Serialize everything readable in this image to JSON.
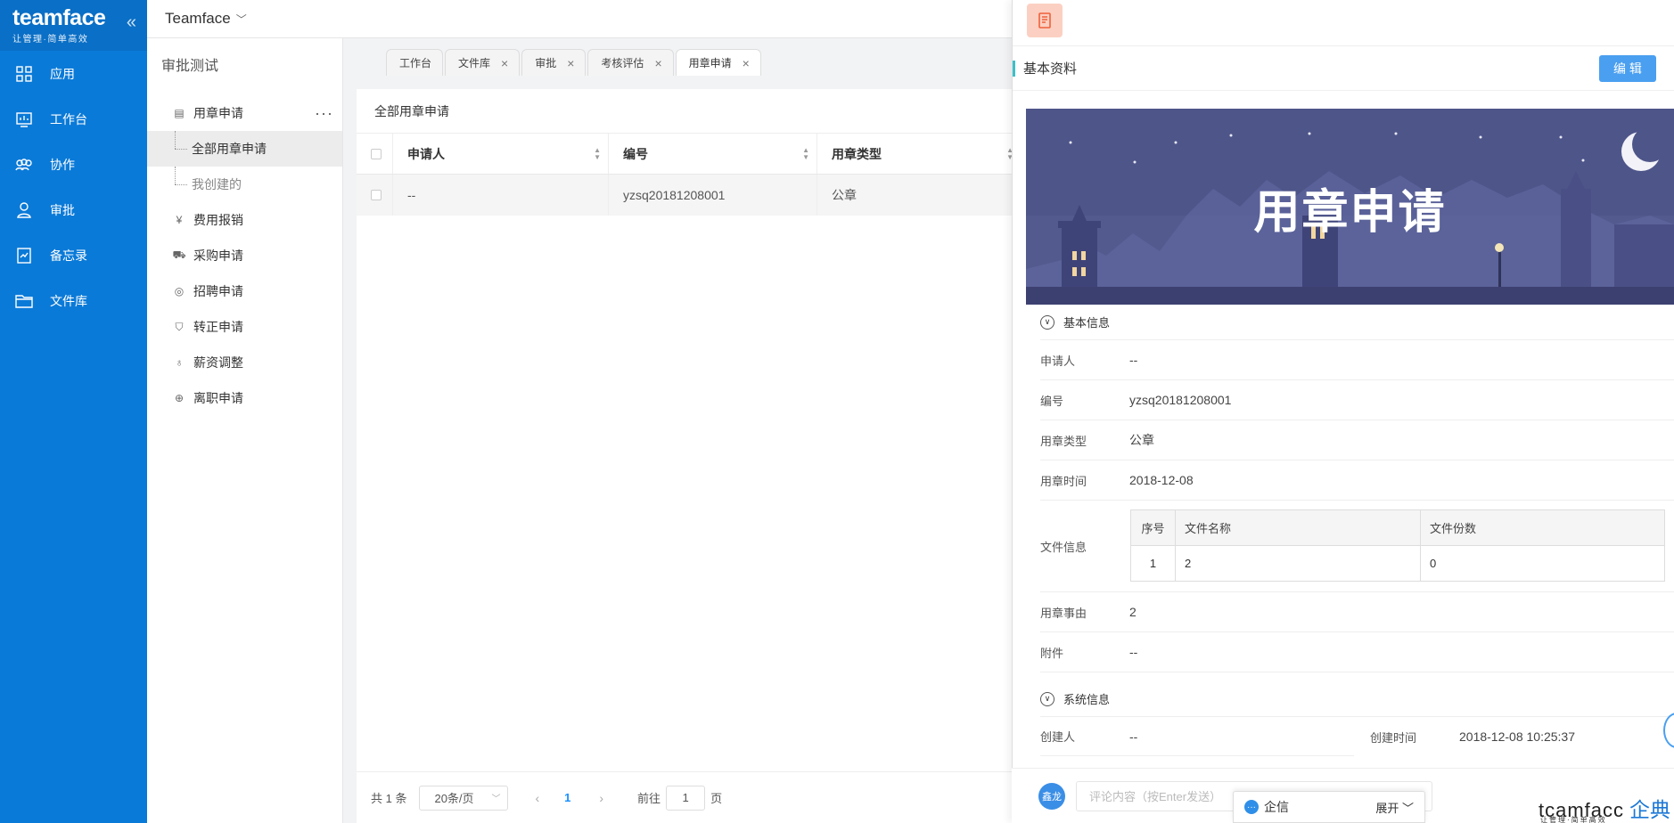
{
  "brand": {
    "logo": "teamface",
    "slogan": "让管理·简单高效"
  },
  "nav": [
    {
      "label": "应用",
      "icon": "grid-icon"
    },
    {
      "label": "工作台",
      "icon": "dashboard-icon"
    },
    {
      "label": "协作",
      "icon": "team-icon"
    },
    {
      "label": "审批",
      "icon": "user-check-icon"
    },
    {
      "label": "备忘录",
      "icon": "memo-icon"
    },
    {
      "label": "文件库",
      "icon": "folder-icon"
    }
  ],
  "topbar": {
    "company": "Teamface"
  },
  "subnav": {
    "title": "审批测试",
    "group_main": "用章申请",
    "child_all": "全部用章申请",
    "child_mine": "我创建的",
    "groups": [
      "费用报销",
      "采购申请",
      "招聘申请",
      "转正申请",
      "薪资调整",
      "离职申请"
    ]
  },
  "tabs": [
    {
      "label": "工作台",
      "closable": false
    },
    {
      "label": "文件库",
      "closable": true
    },
    {
      "label": "审批",
      "closable": true
    },
    {
      "label": "考核评估",
      "closable": true
    },
    {
      "label": "用章申请",
      "closable": true,
      "active": true
    }
  ],
  "main": {
    "title": "全部用章申请",
    "columns": [
      "申请人",
      "编号",
      "用章类型"
    ],
    "rows": [
      {
        "applicant": "--",
        "number": "yzsq20181208001",
        "type": "公章"
      }
    ],
    "pager": {
      "total": "共 1 条",
      "page_size": "20条/页",
      "current": "1",
      "goto_label": "前往",
      "goto_value": "1",
      "page_unit": "页"
    }
  },
  "detail": {
    "section_title": "基本资料",
    "edit_label": "编 辑",
    "banner_title": "用章申请",
    "group_basic": "基本信息",
    "fields": {
      "applicant_label": "申请人",
      "applicant_value": "--",
      "number_label": "编号",
      "number_value": "yzsq20181208001",
      "type_label": "用章类型",
      "type_value": "公章",
      "time_label": "用章时间",
      "time_value": "2018-12-08",
      "file_label": "文件信息",
      "reason_label": "用章事由",
      "reason_value": "2",
      "attach_label": "附件",
      "attach_value": "--"
    },
    "file_table": {
      "headers": [
        "序号",
        "文件名称",
        "文件份数"
      ],
      "row": [
        "1",
        "2",
        "0"
      ]
    },
    "group_system": "系统信息",
    "creator_label": "创建人",
    "creator_value": "--",
    "created_label": "创建时间",
    "created_value": "2018-12-08 10:25:37",
    "comment_avatar": "鑫龙",
    "comment_placeholder": "评论内容（按Enter发送）"
  },
  "qixin": {
    "label": "企信",
    "expand": "展开"
  },
  "watermark": {
    "a": "tcamfacc",
    "b": "企典",
    "sub": "让管理·简单高效"
  }
}
